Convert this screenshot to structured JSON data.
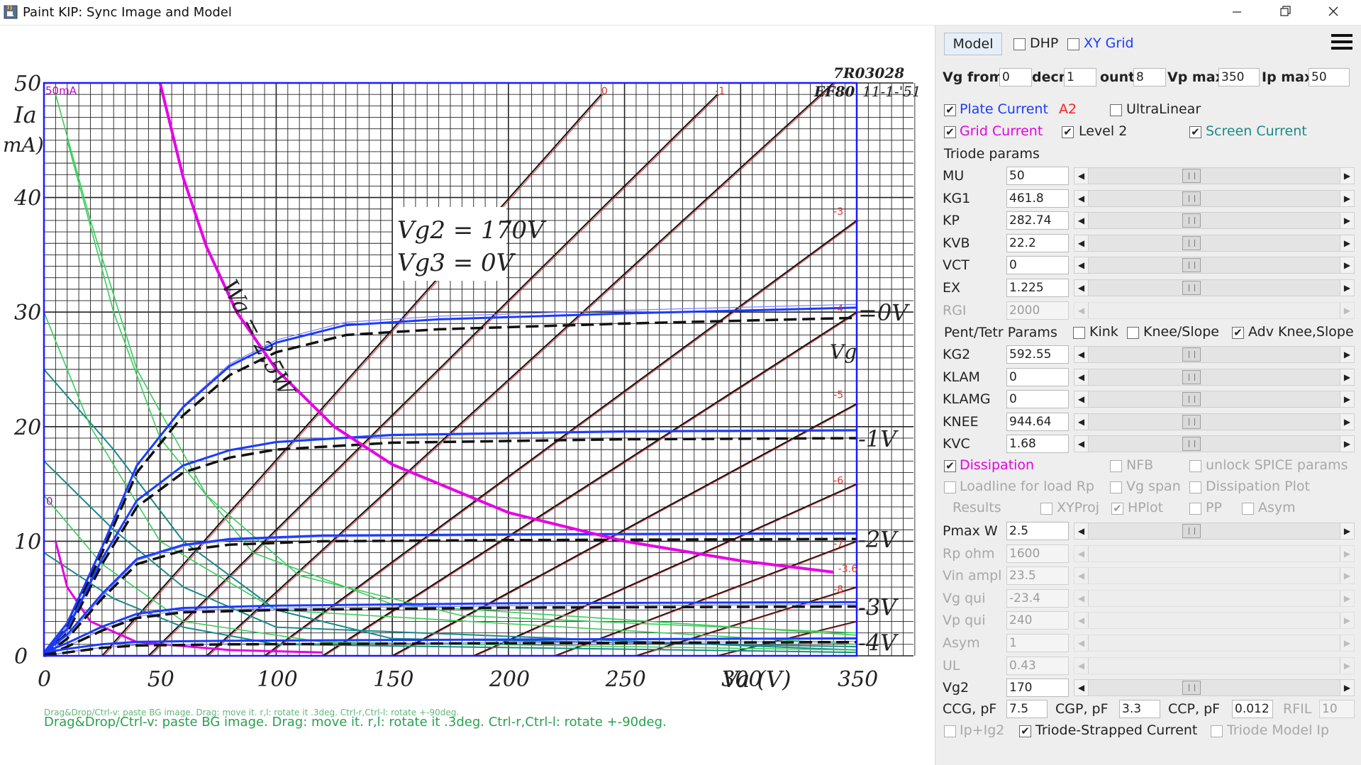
{
  "window": {
    "title": "Paint KIP: Sync Image and Model",
    "minimize_icon": "minimize-icon",
    "maximize_icon": "restore-icon",
    "close_icon": "close-icon"
  },
  "plot": {
    "y_ticks": [
      "0",
      "10",
      "20",
      "30",
      "40",
      "50"
    ],
    "x_ticks": [
      "0",
      "50",
      "100",
      "150",
      "200",
      "250",
      "300",
      "350"
    ],
    "y_label": "Ia",
    "y_unit": "mA)",
    "x_label": "Va (V)",
    "top_left_label": "50mA",
    "left_marker": "0",
    "tube_code": "7R03028",
    "tube_name": "EF80",
    "date": "11-1-'51",
    "vg2_label": "Vg2 = 170V",
    "vg3_label": "Vg3 = 0V",
    "wa_label": "Wa = 2,5W",
    "vg_label": "Vg",
    "curve_labels": [
      "=0V",
      "-1V",
      "-2V",
      "-3V",
      "-4V"
    ],
    "top_marks": [
      "0",
      "-1",
      "-3",
      "-4",
      "-5",
      "-6",
      "-7",
      "-8",
      "-3.6"
    ],
    "status_line": "Drag&Drop/Ctrl-v: paste BG image. Drag: move it. r,l: rotate it .3deg. Ctrl-r,Ctrl-l: rotate +-90deg.",
    "status_ghost": "Drag&Drop/Ctrl-v: paste BG image. Drag: move it. r,l: rotate it .3deg. Ctrl-r,Ctrl-l: rotate +-90deg."
  },
  "chart_data": {
    "type": "line",
    "title": "",
    "xlabel": "Va (V)",
    "ylabel": "Ia (mA)",
    "xlim": [
      0,
      350
    ],
    "ylim": [
      0,
      50
    ],
    "grid": true,
    "series": [
      {
        "name": "=0V",
        "points": [
          [
            0,
            0
          ],
          [
            10,
            2.5
          ],
          [
            25,
            9
          ],
          [
            40,
            16
          ],
          [
            60,
            21
          ],
          [
            80,
            24.5
          ],
          [
            100,
            26.5
          ],
          [
            130,
            28
          ],
          [
            170,
            28.5
          ],
          [
            250,
            29
          ],
          [
            350,
            29.5
          ]
        ]
      },
      {
        "name": "-1V",
        "points": [
          [
            0,
            0
          ],
          [
            10,
            2
          ],
          [
            25,
            8
          ],
          [
            40,
            13
          ],
          [
            60,
            16
          ],
          [
            80,
            17.3
          ],
          [
            100,
            18
          ],
          [
            150,
            18.6
          ],
          [
            250,
            18.9
          ],
          [
            350,
            19
          ]
        ]
      },
      {
        "name": "-2V",
        "points": [
          [
            0,
            0
          ],
          [
            10,
            1.5
          ],
          [
            25,
            5
          ],
          [
            40,
            8
          ],
          [
            60,
            9.2
          ],
          [
            80,
            9.7
          ],
          [
            120,
            10
          ],
          [
            200,
            10.1
          ],
          [
            350,
            10.2
          ]
        ]
      },
      {
        "name": "-3V",
        "points": [
          [
            0,
            0
          ],
          [
            10,
            0.8
          ],
          [
            25,
            2.2
          ],
          [
            40,
            3.3
          ],
          [
            60,
            3.8
          ],
          [
            100,
            4
          ],
          [
            200,
            4.2
          ],
          [
            350,
            4.3
          ]
        ]
      },
      {
        "name": "-4V",
        "points": [
          [
            0,
            0
          ],
          [
            10,
            0.3
          ],
          [
            25,
            0.7
          ],
          [
            40,
            0.9
          ],
          [
            80,
            1
          ],
          [
            200,
            1.1
          ],
          [
            350,
            1.2
          ]
        ]
      },
      {
        "name": "Wa = 2,5W",
        "points": [
          [
            50,
            50
          ],
          [
            60,
            41.7
          ],
          [
            70,
            35.7
          ],
          [
            83,
            30
          ],
          [
            100,
            25
          ],
          [
            125,
            20
          ],
          [
            150,
            16.7
          ],
          [
            200,
            12.5
          ],
          [
            250,
            10
          ],
          [
            300,
            8.3
          ],
          [
            340,
            7.3
          ]
        ]
      }
    ]
  },
  "panel": {
    "model_label": "Model",
    "dhp_label": "DHP",
    "xygrid_label": "XY Grid",
    "menu_icon": "hamburger-menu-icon",
    "vg_from_label": "Vg from",
    "vg_from_value": "0",
    "decr_label": "decr",
    "decr_value": "1",
    "count_label": "ount",
    "count_value": "8",
    "vpmax_label": "Vp max",
    "vpmax_value": "350",
    "ipmax_label": "Ip max",
    "ipmax_value": "50",
    "plate_current_label": "Plate Current",
    "a2_label": "A2",
    "ultralinear_label": "UltraLinear",
    "grid_current_label": "Grid Current",
    "level2_label": "Level 2",
    "screen_current_label": "Screen Current",
    "triode_params_label": "Triode params",
    "triode_params": [
      {
        "label": "MU",
        "value": "50"
      },
      {
        "label": "KG1",
        "value": "461.8"
      },
      {
        "label": "KP",
        "value": "282.74"
      },
      {
        "label": "KVB",
        "value": "22.2"
      },
      {
        "label": "VCT",
        "value": "0"
      },
      {
        "label": "EX",
        "value": "1.225"
      },
      {
        "label": "RGI",
        "value": "2000"
      }
    ],
    "pent_params_label": "Pent/Tetr Params",
    "kink_label": "Kink",
    "knee_slope_label": "Knee/Slope",
    "adv_knee_label": "Adv Knee,Slope",
    "pent_params": [
      {
        "label": "KG2",
        "value": "592.55"
      },
      {
        "label": "KLAM",
        "value": "0"
      },
      {
        "label": "KLAMG",
        "value": "0"
      },
      {
        "label": "KNEE",
        "value": "944.64"
      },
      {
        "label": "KVC",
        "value": "1.68"
      }
    ],
    "dissipation_label": "Dissipation",
    "nfb_label": "NFB",
    "unlock_spice_label": "unlock SPICE params",
    "loadline_label": "Loadline for load Rp",
    "vg_span_label": "Vg span",
    "dissipation_plot_label": "Dissipation Plot",
    "results_label": "Results",
    "xyproj_label": "XYProj",
    "hplot_label": "HPlot",
    "pp_label": "PP",
    "asym_check_label": "Asym",
    "load_params": [
      {
        "label": "Pmax W",
        "value": "2.5"
      },
      {
        "label": "Rp ohm",
        "value": "1600"
      },
      {
        "label": "Vin ampl",
        "value": "23.5"
      },
      {
        "label": "Vg qui",
        "value": "-23.4"
      },
      {
        "label": "Vp qui",
        "value": "240"
      },
      {
        "label": "Asym",
        "value": "1"
      },
      {
        "label": "UL",
        "value": "0.43"
      },
      {
        "label": "Vg2",
        "value": "170"
      }
    ],
    "ccg_label": "CCG, pF",
    "ccg_value": "7.5",
    "cgp_label": "CGP, pF",
    "cgp_value": "3.3",
    "ccp_label": "CCP, pF",
    "ccp_value": "0.012",
    "rfil_label": "RFIL",
    "rfil_value": "10",
    "ip_ig2_label": "Ip+Ig2",
    "triode_strapped_label": "Triode-Strapped Current",
    "triode_model_label": "Triode Model Ip",
    "colors": {
      "plate": "#1a3cff",
      "grid": "#e600e6",
      "screen": "#1a8a8a",
      "a2": "#ff2020"
    }
  }
}
